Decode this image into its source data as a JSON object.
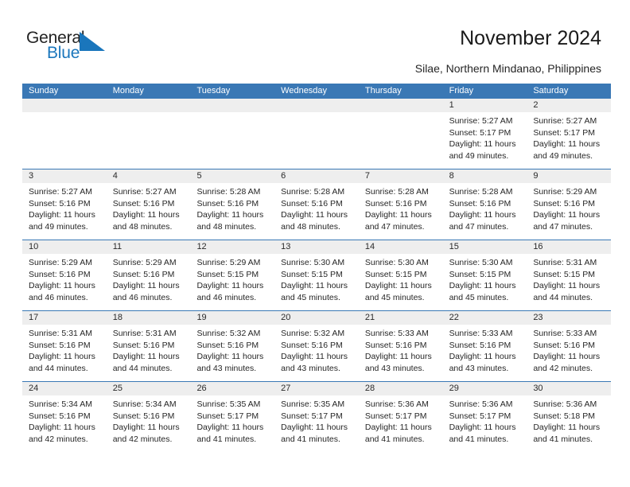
{
  "brand": {
    "word_one": "General",
    "word_two": "Blue",
    "triangle_color": "#1a76bc",
    "icon": "general-blue-logo"
  },
  "header": {
    "title": "November 2024",
    "subtitle": "Silae, Northern Mindanao, Philippines"
  },
  "colors": {
    "header_blue": "#3a78b5",
    "daynum_gray": "#eeeeee",
    "text": "#262626"
  },
  "weekday_headers": [
    "Sunday",
    "Monday",
    "Tuesday",
    "Wednesday",
    "Thursday",
    "Friday",
    "Saturday"
  ],
  "calendar": {
    "month": "November",
    "year": 2024,
    "weeks": [
      [
        {
          "day": "",
          "lines": []
        },
        {
          "day": "",
          "lines": []
        },
        {
          "day": "",
          "lines": []
        },
        {
          "day": "",
          "lines": []
        },
        {
          "day": "",
          "lines": []
        },
        {
          "day": "1",
          "lines": [
            "Sunrise: 5:27 AM",
            "Sunset: 5:17 PM",
            "Daylight: 11 hours",
            "and 49 minutes."
          ]
        },
        {
          "day": "2",
          "lines": [
            "Sunrise: 5:27 AM",
            "Sunset: 5:17 PM",
            "Daylight: 11 hours",
            "and 49 minutes."
          ]
        }
      ],
      [
        {
          "day": "3",
          "lines": [
            "Sunrise: 5:27 AM",
            "Sunset: 5:16 PM",
            "Daylight: 11 hours",
            "and 49 minutes."
          ]
        },
        {
          "day": "4",
          "lines": [
            "Sunrise: 5:27 AM",
            "Sunset: 5:16 PM",
            "Daylight: 11 hours",
            "and 48 minutes."
          ]
        },
        {
          "day": "5",
          "lines": [
            "Sunrise: 5:28 AM",
            "Sunset: 5:16 PM",
            "Daylight: 11 hours",
            "and 48 minutes."
          ]
        },
        {
          "day": "6",
          "lines": [
            "Sunrise: 5:28 AM",
            "Sunset: 5:16 PM",
            "Daylight: 11 hours",
            "and 48 minutes."
          ]
        },
        {
          "day": "7",
          "lines": [
            "Sunrise: 5:28 AM",
            "Sunset: 5:16 PM",
            "Daylight: 11 hours",
            "and 47 minutes."
          ]
        },
        {
          "day": "8",
          "lines": [
            "Sunrise: 5:28 AM",
            "Sunset: 5:16 PM",
            "Daylight: 11 hours",
            "and 47 minutes."
          ]
        },
        {
          "day": "9",
          "lines": [
            "Sunrise: 5:29 AM",
            "Sunset: 5:16 PM",
            "Daylight: 11 hours",
            "and 47 minutes."
          ]
        }
      ],
      [
        {
          "day": "10",
          "lines": [
            "Sunrise: 5:29 AM",
            "Sunset: 5:16 PM",
            "Daylight: 11 hours",
            "and 46 minutes."
          ]
        },
        {
          "day": "11",
          "lines": [
            "Sunrise: 5:29 AM",
            "Sunset: 5:16 PM",
            "Daylight: 11 hours",
            "and 46 minutes."
          ]
        },
        {
          "day": "12",
          "lines": [
            "Sunrise: 5:29 AM",
            "Sunset: 5:15 PM",
            "Daylight: 11 hours",
            "and 46 minutes."
          ]
        },
        {
          "day": "13",
          "lines": [
            "Sunrise: 5:30 AM",
            "Sunset: 5:15 PM",
            "Daylight: 11 hours",
            "and 45 minutes."
          ]
        },
        {
          "day": "14",
          "lines": [
            "Sunrise: 5:30 AM",
            "Sunset: 5:15 PM",
            "Daylight: 11 hours",
            "and 45 minutes."
          ]
        },
        {
          "day": "15",
          "lines": [
            "Sunrise: 5:30 AM",
            "Sunset: 5:15 PM",
            "Daylight: 11 hours",
            "and 45 minutes."
          ]
        },
        {
          "day": "16",
          "lines": [
            "Sunrise: 5:31 AM",
            "Sunset: 5:15 PM",
            "Daylight: 11 hours",
            "and 44 minutes."
          ]
        }
      ],
      [
        {
          "day": "17",
          "lines": [
            "Sunrise: 5:31 AM",
            "Sunset: 5:16 PM",
            "Daylight: 11 hours",
            "and 44 minutes."
          ]
        },
        {
          "day": "18",
          "lines": [
            "Sunrise: 5:31 AM",
            "Sunset: 5:16 PM",
            "Daylight: 11 hours",
            "and 44 minutes."
          ]
        },
        {
          "day": "19",
          "lines": [
            "Sunrise: 5:32 AM",
            "Sunset: 5:16 PM",
            "Daylight: 11 hours",
            "and 43 minutes."
          ]
        },
        {
          "day": "20",
          "lines": [
            "Sunrise: 5:32 AM",
            "Sunset: 5:16 PM",
            "Daylight: 11 hours",
            "and 43 minutes."
          ]
        },
        {
          "day": "21",
          "lines": [
            "Sunrise: 5:33 AM",
            "Sunset: 5:16 PM",
            "Daylight: 11 hours",
            "and 43 minutes."
          ]
        },
        {
          "day": "22",
          "lines": [
            "Sunrise: 5:33 AM",
            "Sunset: 5:16 PM",
            "Daylight: 11 hours",
            "and 43 minutes."
          ]
        },
        {
          "day": "23",
          "lines": [
            "Sunrise: 5:33 AM",
            "Sunset: 5:16 PM",
            "Daylight: 11 hours",
            "and 42 minutes."
          ]
        }
      ],
      [
        {
          "day": "24",
          "lines": [
            "Sunrise: 5:34 AM",
            "Sunset: 5:16 PM",
            "Daylight: 11 hours",
            "and 42 minutes."
          ]
        },
        {
          "day": "25",
          "lines": [
            "Sunrise: 5:34 AM",
            "Sunset: 5:16 PM",
            "Daylight: 11 hours",
            "and 42 minutes."
          ]
        },
        {
          "day": "26",
          "lines": [
            "Sunrise: 5:35 AM",
            "Sunset: 5:17 PM",
            "Daylight: 11 hours",
            "and 41 minutes."
          ]
        },
        {
          "day": "27",
          "lines": [
            "Sunrise: 5:35 AM",
            "Sunset: 5:17 PM",
            "Daylight: 11 hours",
            "and 41 minutes."
          ]
        },
        {
          "day": "28",
          "lines": [
            "Sunrise: 5:36 AM",
            "Sunset: 5:17 PM",
            "Daylight: 11 hours",
            "and 41 minutes."
          ]
        },
        {
          "day": "29",
          "lines": [
            "Sunrise: 5:36 AM",
            "Sunset: 5:17 PM",
            "Daylight: 11 hours",
            "and 41 minutes."
          ]
        },
        {
          "day": "30",
          "lines": [
            "Sunrise: 5:36 AM",
            "Sunset: 5:18 PM",
            "Daylight: 11 hours",
            "and 41 minutes."
          ]
        }
      ]
    ]
  }
}
